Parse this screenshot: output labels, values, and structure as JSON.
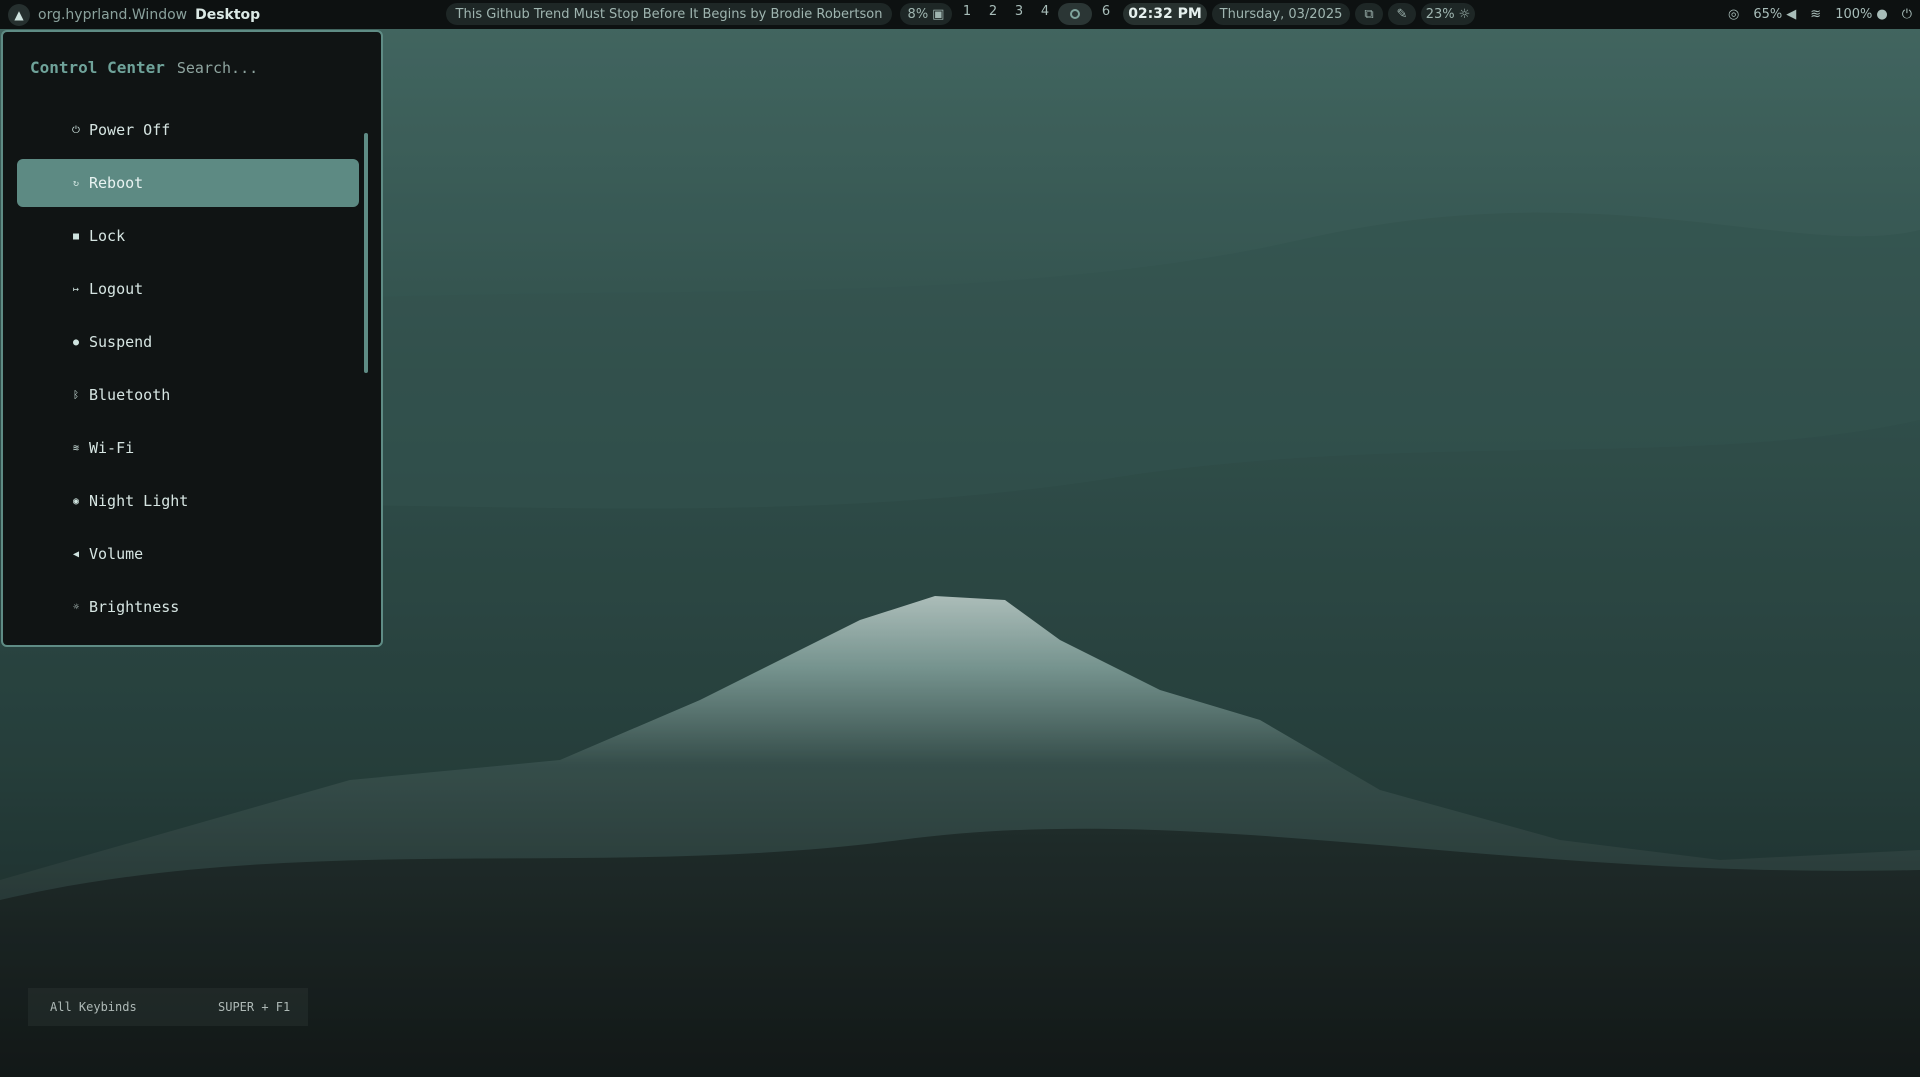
{
  "topbar": {
    "window_class": "org.hyprland.Window",
    "window_title": "Desktop",
    "media_title": "This Github Trend Must Stop Before It Begins by Brodie Robertson",
    "cpu": "8%",
    "workspaces": [
      "1",
      "2",
      "3",
      "4",
      "6"
    ],
    "active_workspace": "5",
    "time": "02:32 PM",
    "date": "Thursday, 03/2025",
    "brightness": "23%",
    "volume": "65%",
    "battery": "100%"
  },
  "control_center": {
    "title": "Control Center",
    "search_placeholder": "Search...",
    "items": [
      {
        "label": "Power Off",
        "icon": "power-icon"
      },
      {
        "label": "Reboot",
        "icon": "reboot-icon"
      },
      {
        "label": "Lock",
        "icon": "lock-icon"
      },
      {
        "label": "Logout",
        "icon": "logout-icon"
      },
      {
        "label": "Suspend",
        "icon": "suspend-icon"
      },
      {
        "label": "Bluetooth",
        "icon": "bluetooth-icon"
      },
      {
        "label": "Wi-Fi",
        "icon": "wifi-icon"
      },
      {
        "label": "Night Light",
        "icon": "night-light-icon"
      },
      {
        "label": "Volume",
        "icon": "volume-icon"
      },
      {
        "label": "Brightness",
        "icon": "brightness-icon"
      }
    ],
    "selected": "Reboot"
  },
  "keybind_hint": {
    "label": "All Keybinds",
    "keys": "SUPER + F1"
  },
  "colors": {
    "accent": "#5d8a83",
    "panel_bg": "#101414",
    "border": "#5f8c85",
    "bar_bg": "#0d1111"
  }
}
